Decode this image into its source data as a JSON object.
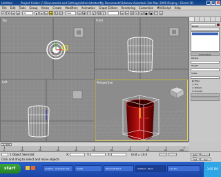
{
  "window": {
    "doc_name": "Untitled",
    "title": "Project Folder: C:\\Documents and Settings\\Administrator\\My Documents\\3dsmax    Autodesk 3ds Max  2009    Display : Direct 3D",
    "min": "_",
    "max": "□",
    "close": "×"
  },
  "menu": [
    "File",
    "Edit",
    "Tools",
    "Group",
    "Views",
    "Create",
    "Modifiers",
    "Animation",
    "Graph Editors",
    "Rendering",
    "Customize",
    "MAXScript",
    "Help"
  ],
  "toolbar": {
    "selection_filter": "All",
    "reference_coord": "View",
    "named_selection": ""
  },
  "viewports": {
    "top_left": "Top",
    "top_right": "Front",
    "bottom_left": "Left",
    "bottom_right": "Perspective"
  },
  "command_panel": {
    "object_name": "Box01",
    "rollouts": [
      "Parameters",
      "Radius",
      "Height",
      "Sides"
    ],
    "options": [
      "Edge",
      "Top",
      "Bottom",
      "Smooth"
    ]
  },
  "timeline": {
    "slider": "0 / 100",
    "ticks": [
      "0",
      "10",
      "20",
      "30",
      "40",
      "50",
      "60",
      "70",
      "80",
      "90",
      "100"
    ]
  },
  "status": {
    "selected": "1 Object Selected",
    "prompt": "Click and drag to select and move objects",
    "x_label": "X:",
    "y_label": "Y:",
    "z_label": "Z:",
    "grid": "Grid = 10.0",
    "auto_key": "Auto Key",
    "set_key": "Set Key",
    "key_filters": "Key Filters...",
    "selected_label": "Selected"
  },
  "taskbar": {
    "start": "start",
    "tasks": [
      "Untitled - Autodesk 3ds...",
      "Drafts",
      "Microsoft Word",
      "Untitled - Paint",
      "cup 3D..."
    ],
    "clock": "3:05 PM"
  },
  "colors": {
    "titlebar": "#0b3f86",
    "viewport_bg": "#8c8c8c",
    "selected_object": "#a80000",
    "active_border": "#e0d260",
    "start_button": "#3aa63a"
  }
}
